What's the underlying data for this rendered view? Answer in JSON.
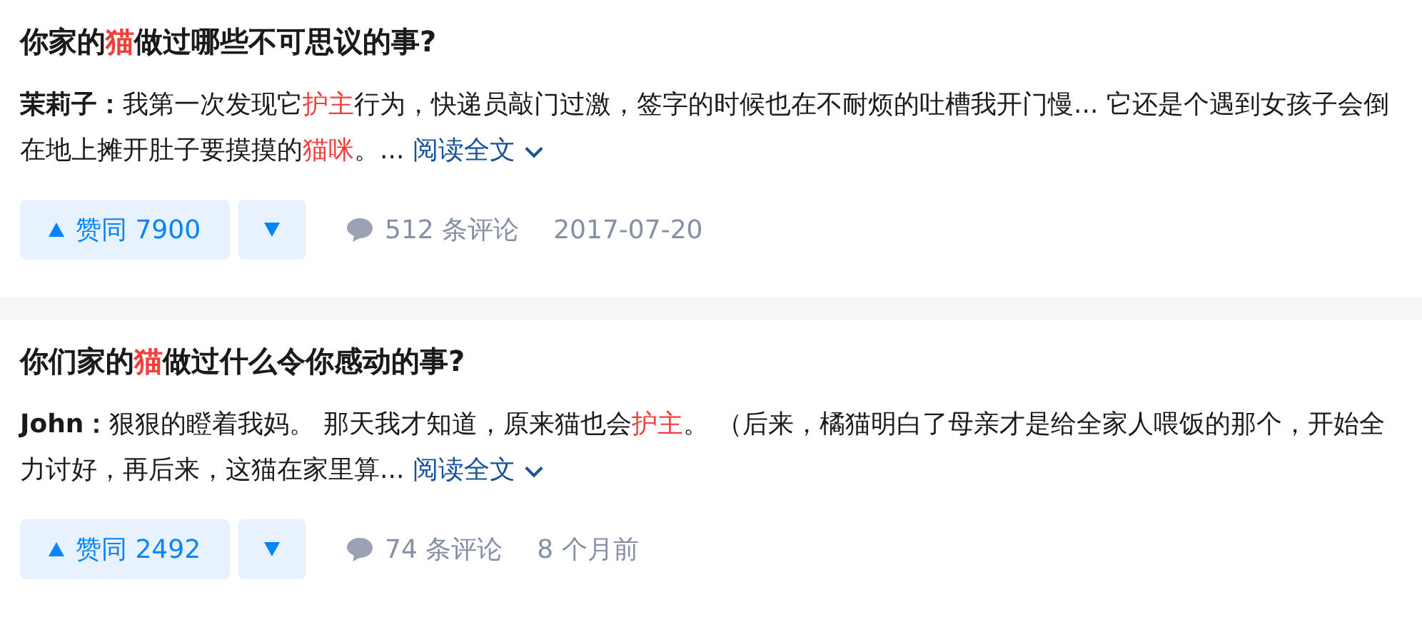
{
  "results": [
    {
      "title": [
        {
          "text": "你家的",
          "highlight": false
        },
        {
          "text": "猫",
          "highlight": true
        },
        {
          "text": "做过哪些不可思议的事?",
          "highlight": false
        }
      ],
      "author": "茉莉子：",
      "excerpt": [
        {
          "text": "我第一次发现它",
          "highlight": false
        },
        {
          "text": "护主",
          "highlight": true
        },
        {
          "text": "行为，快递员敲门过激，签字的时候也在不耐烦的吐槽我开门慢... 它还是个遇到女孩子会倒在地上摊开肚子要摸摸的",
          "highlight": false
        },
        {
          "text": "猫咪",
          "highlight": true
        },
        {
          "text": "。... ",
          "highlight": false
        }
      ],
      "read_more": "阅读全文",
      "votes": "赞同 7900",
      "comments": "512 条评论",
      "time": "2017-07-20"
    },
    {
      "title": [
        {
          "text": "你们家的",
          "highlight": false
        },
        {
          "text": "猫",
          "highlight": true
        },
        {
          "text": "做过什么令你感动的事?",
          "highlight": false
        }
      ],
      "author": "John：",
      "excerpt": [
        {
          "text": "狠狠的瞪着我妈。 那天我才知道，原来猫也会",
          "highlight": false
        },
        {
          "text": "护主",
          "highlight": true
        },
        {
          "text": "。 （后来，橘猫明白了母亲才是给全家人喂饭的那个，开始全力讨好，再后来，这猫在家里算... ",
          "highlight": false
        }
      ],
      "read_more": "阅读全文",
      "votes": "赞同 2492",
      "comments": "74 条评论",
      "time": "8 个月前"
    }
  ]
}
